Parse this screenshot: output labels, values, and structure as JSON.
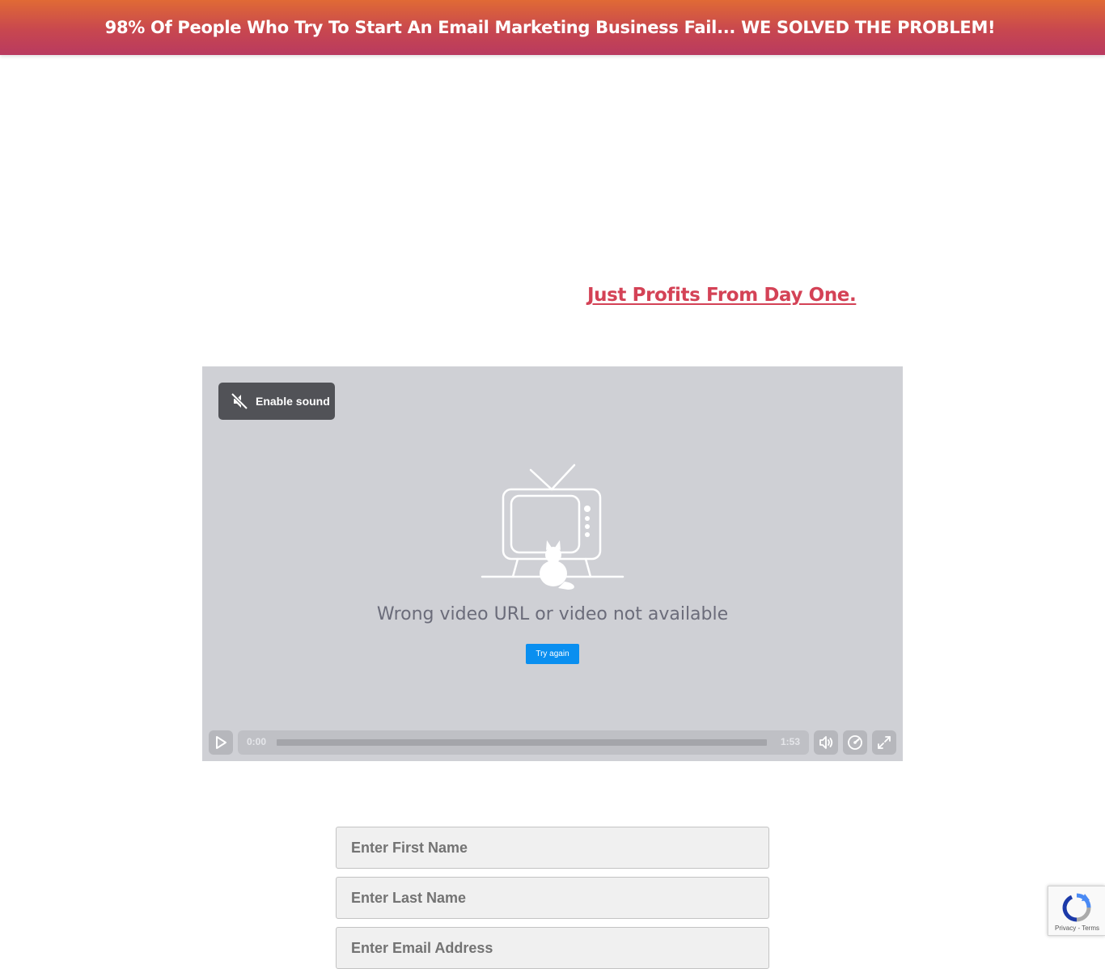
{
  "banner": {
    "text": "98% Of People Who Try To Start An Email Marketing Business Fail... WE SOLVED THE PROBLEM!"
  },
  "headline": {
    "link_text": "Just Profits From Day One."
  },
  "video_player": {
    "enable_sound_label": "Enable sound",
    "error_message": "Wrong video URL or video not available",
    "try_again_label": "Try again",
    "current_time": "0:00",
    "duration": "1:53",
    "progress": 0
  },
  "form": {
    "first_name_placeholder": "Enter First Name",
    "last_name_placeholder": "Enter Last Name",
    "email_placeholder": "Enter Email Address"
  },
  "recaptcha": {
    "privacy_label": "Privacy",
    "separator": " - ",
    "terms_label": "Terms"
  },
  "colors": {
    "banner_top": "#e06a35",
    "banner_bottom": "#b93a60",
    "headline_link": "#d44256",
    "player_background": "#cfd0d5",
    "try_again_button": "#0a8ff0"
  }
}
